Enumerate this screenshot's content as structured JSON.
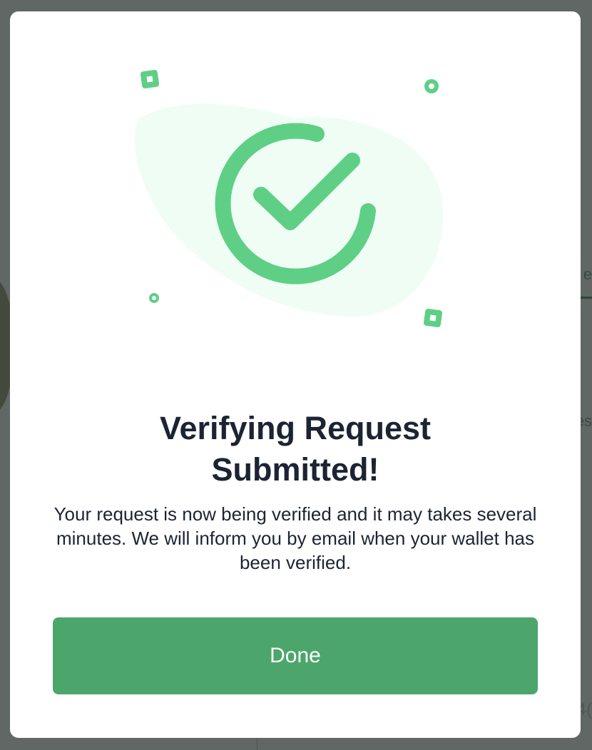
{
  "dialog": {
    "title_line1": "Verifying Request",
    "title_line2": "Submitted!",
    "description": "Your request is now being verified and it may takes several minutes. We will inform you by email when your wallet has been verified.",
    "done_label": "Done"
  },
  "illustration": {
    "icon": "check-circle-icon",
    "accent_color": "#5fcf86",
    "blob_color": "#effdf5"
  },
  "background": {
    "partial_tab_text": "e",
    "partial_side_text": "es",
    "partial_number": "4("
  },
  "colors": {
    "primary_button": "#4ca66c",
    "text": "#1c2434",
    "overlay": "#5d6460"
  }
}
